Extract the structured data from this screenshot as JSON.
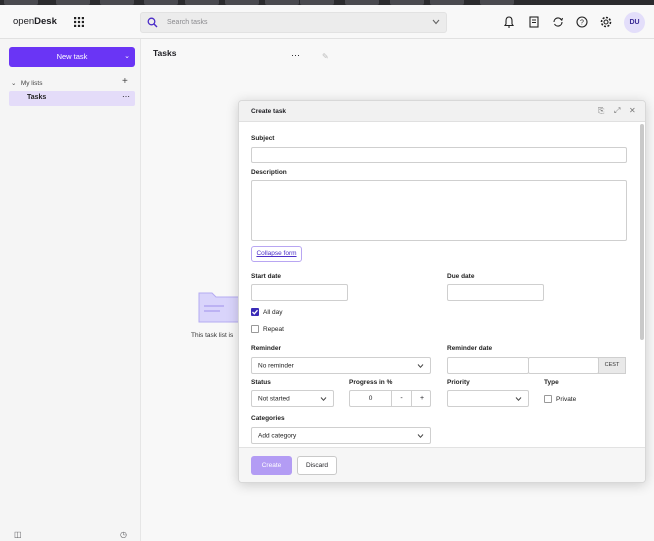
{
  "app": {
    "brand_light": "open",
    "brand_bold": "Desk",
    "search_placeholder": "Search tasks",
    "user_initials": "DU",
    "accent_color": "#6a35f5"
  },
  "sidebar": {
    "new_task_label": "New task",
    "section_label": "My lists",
    "lists": [
      {
        "label": "Tasks",
        "selected": true
      }
    ]
  },
  "main": {
    "title": "Tasks",
    "empty_message": "This task list is"
  },
  "dialog": {
    "title": "Create task",
    "subject_label": "Subject",
    "subject_value": "",
    "description_label": "Description",
    "description_value": "",
    "collapse_link": "Collapse form",
    "start_date_label": "Start date",
    "start_date_value": "",
    "due_date_label": "Due date",
    "due_date_value": "",
    "all_day_label": "All day",
    "all_day_checked": true,
    "repeat_label": "Repeat",
    "repeat_checked": false,
    "reminder_label": "Reminder",
    "reminder_value": "No reminder",
    "reminder_date_label": "Reminder date",
    "timezone": "CEST",
    "status_label": "Status",
    "status_value": "Not started",
    "progress_label": "Progress in %",
    "progress_value": "0",
    "minus": "-",
    "plus": "+",
    "priority_label": "Priority",
    "priority_value": "",
    "type_label": "Type",
    "private_label": "Private",
    "private_checked": false,
    "categories_label": "Categories",
    "categories_placeholder": "Add category",
    "create_label": "Create",
    "discard_label": "Discard"
  }
}
